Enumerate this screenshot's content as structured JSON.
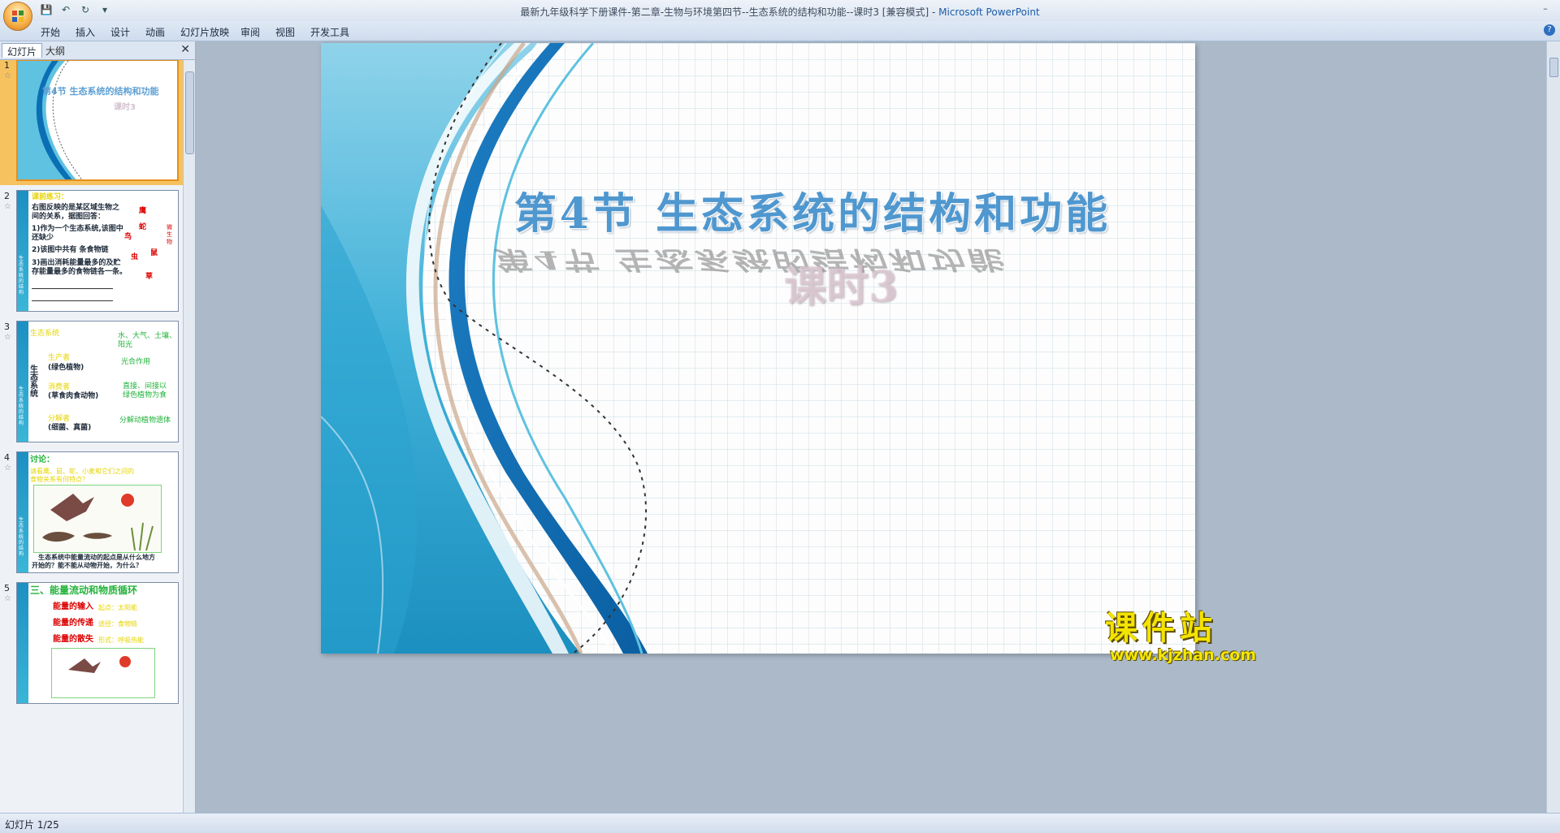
{
  "window": {
    "title_doc": "最新九年级科学下册课件-第二章-生物与环境第四节--生态系统的结构和功能--课时3 [兼容模式] - ",
    "title_app": "Microsoft PowerPoint",
    "minimize_glyph": "–",
    "help_glyph": "?"
  },
  "quick_access": {
    "save": "💾",
    "undo": "↶",
    "redo": "↻",
    "customize": "▾"
  },
  "ribbon": {
    "tabs": [
      "开始",
      "插入",
      "设计",
      "动画",
      "幻灯片放映",
      "审阅",
      "视图",
      "开发工具"
    ]
  },
  "panel": {
    "tabs": [
      "幻灯片",
      "大纲"
    ],
    "close": "✕",
    "slides": [
      {
        "num": "1",
        "star": "☆",
        "title": "第4节  生态系统的结构和功能",
        "subtitle": "课时3"
      },
      {
        "num": "2",
        "star": "☆",
        "lines": [
          "课前练习：",
          "右图反映的是某区域生物之",
          "间的关系，据图回答：",
          "1)作为一个生态系统,该图中",
          "还缺少",
          "2)该图中共有     条食物链",
          "3)画出消耗能量最多的及贮",
          "存能量最多的食物链各一条。"
        ],
        "labels": [
          "鹰",
          "蛇",
          "鸟",
          "鼠",
          "虫",
          "草",
          "微",
          "生",
          "物"
        ],
        "stripe": "生态系统的结构"
      },
      {
        "num": "3",
        "star": "☆",
        "left": [
          "生态系统",
          "生产者",
          "(绿色植物)",
          "消费者",
          "(草食肉食动物)",
          "分解者",
          "(细菌、真菌)"
        ],
        "right": [
          "水、大气、土壤、",
          "阳光",
          "光合作用",
          "直接、间接以",
          "绿色植物为食",
          "分解动植物遗体"
        ],
        "stripe": "生态系统的结构"
      },
      {
        "num": "4",
        "star": "☆",
        "lines": [
          "讨论：",
          "请看鹰、鼠、蛇、小麦和它们之间的",
          "食物关系有何特点？",
          "生态系统中能量流动的起点是从什么地方",
          "开始的？能不能从动物开始，为什么？"
        ],
        "stripe": "生态系统的结构"
      },
      {
        "num": "5",
        "star": "☆",
        "lines": [
          "三、能量流动和物质循环",
          "能量的输入",
          "能量的传递",
          "能量的散失"
        ],
        "notes": [
          "起点：太阳能",
          "途径：食物链",
          "形式：呼吸热能"
        ]
      }
    ]
  },
  "slide": {
    "title": "第4节  生态系统的结构和功能",
    "subtitle": "课时3"
  },
  "watermark": {
    "main": "课件站",
    "url": "www.kjzhan.com"
  },
  "status": {
    "text": "幻灯片 1/25"
  },
  "colors": {
    "title_blue": "#4f97cf",
    "wave_dark": "#0a6fb4",
    "wave_light": "#5fc2e0",
    "selected_slot": "#f6c25f",
    "watermark_yellow": "#f3e300"
  }
}
